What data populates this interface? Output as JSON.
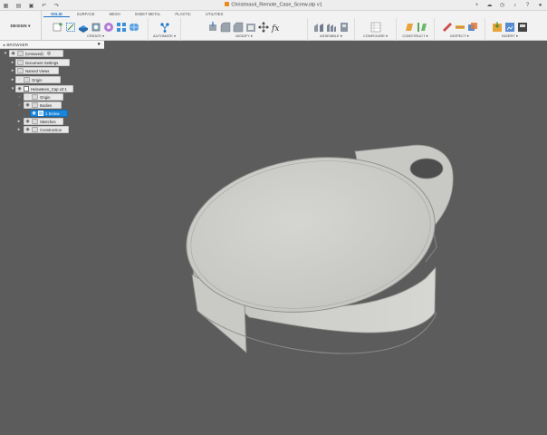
{
  "titlebar": {
    "title": "Christmas4_Remote_Case_Screw.stp v1",
    "left_icons": [
      "grid-icon",
      "file-icon",
      "save-icon",
      "undo-icon",
      "redo-icon"
    ],
    "right_icons": [
      "plus-icon",
      "cloud-icon",
      "clock-icon",
      "bell-icon",
      "help-icon",
      "user-icon"
    ]
  },
  "ribbon": {
    "workspace": "DESIGN",
    "tabs": [
      {
        "label": "SOLID",
        "active": true
      },
      {
        "label": "SURFACE",
        "active": false
      },
      {
        "label": "MESH",
        "active": false
      },
      {
        "label": "SHEET METAL",
        "active": false
      },
      {
        "label": "PLASTIC",
        "active": false
      },
      {
        "label": "UTILITIES",
        "active": false
      }
    ],
    "groups": [
      {
        "label": "CREATE",
        "icons": [
          "new-component-icon",
          "sketch-icon",
          "extrude-icon",
          "revolve-icon",
          "hole-icon",
          "pattern-icon",
          "form-icon"
        ]
      },
      {
        "label": "AUTOMATE",
        "icons": [
          "automate-icon"
        ]
      },
      {
        "label": "MODIFY",
        "icons": [
          "press-pull-icon",
          "fillet-icon",
          "chamfer-icon",
          "shell-icon",
          "move-icon",
          "parameters-icon"
        ]
      },
      {
        "label": "ASSEMBLE",
        "icons": [
          "joint-icon",
          "as-built-joint-icon",
          "rigid-group-icon"
        ]
      },
      {
        "label": "CONFIGURE",
        "icons": [
          "configure-table-icon"
        ]
      },
      {
        "label": "CONSTRUCT",
        "icons": [
          "plane-icon",
          "axis-icon"
        ]
      },
      {
        "label": "INSPECT",
        "icons": [
          "measure-icon",
          "section-icon",
          "interference-icon"
        ]
      },
      {
        "label": "INSERT",
        "icons": [
          "insert-derive-icon",
          "decal-icon",
          "svg-icon"
        ]
      }
    ],
    "accent": "#1a72c9"
  },
  "browser": {
    "title": "BROWSER",
    "tree": [
      {
        "label": "(Unsaved)",
        "type": "root"
      },
      {
        "label": "Document Settings",
        "type": "folder"
      },
      {
        "label": "Named Views",
        "type": "folder"
      },
      {
        "label": "Origin",
        "type": "folder"
      },
      {
        "label": "Helewteen_Cap v2:1",
        "type": "component"
      },
      {
        "label": "Origin",
        "type": "folder"
      },
      {
        "label": "Bodies",
        "type": "folder"
      },
      {
        "label": "1 Screw",
        "type": "body",
        "selected": true
      },
      {
        "label": "Sketches",
        "type": "folder"
      },
      {
        "label": "Construction",
        "type": "folder"
      }
    ]
  },
  "viewport": {
    "background": "#5c5c5c",
    "body_color": "#c9c9c6"
  }
}
